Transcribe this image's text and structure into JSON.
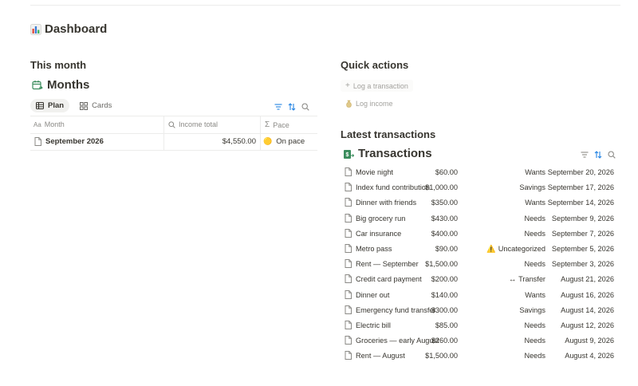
{
  "page": {
    "title": "Dashboard",
    "icon": "bar-chart-icon"
  },
  "left": {
    "section_title": "This month",
    "database": {
      "title": "Months",
      "icon": "calendar-icon",
      "views": [
        {
          "label": "Plan",
          "icon": "table-icon",
          "active": true
        },
        {
          "label": "Cards",
          "icon": "grid-icon",
          "active": false
        }
      ],
      "columns": [
        {
          "label": "Month",
          "icon": "text-property-icon"
        },
        {
          "label": "Income total",
          "icon": "search-property-icon"
        },
        {
          "label": "Pace",
          "icon": "sigma-icon"
        }
      ],
      "rows": [
        {
          "month": "September 2026",
          "income_total": "$4,550.00",
          "pace_emoji": "🟡",
          "pace": "On pace"
        }
      ]
    }
  },
  "right": {
    "quick_actions_title": "Quick actions",
    "quick_actions": [
      {
        "label": "Log a transaction",
        "icon": "plus-icon"
      },
      {
        "label": "Log income",
        "icon": "money-bag-icon"
      }
    ],
    "latest_title": "Latest transactions",
    "database": {
      "title": "Transactions",
      "icon": "money-icon",
      "rows": [
        {
          "name": "Movie night",
          "amount": "$60.00",
          "category": "Wants",
          "date": "September 20, 2026"
        },
        {
          "name": "Index fund contribution",
          "amount": "$1,000.00",
          "category": "Savings",
          "date": "September 17, 2026"
        },
        {
          "name": "Dinner with friends",
          "amount": "$350.00",
          "category": "Wants",
          "date": "September 14, 2026"
        },
        {
          "name": "Big grocery run",
          "amount": "$430.00",
          "category": "Needs",
          "date": "September 9, 2026"
        },
        {
          "name": "Car insurance",
          "amount": "$400.00",
          "category": "Needs",
          "date": "September 7, 2026"
        },
        {
          "name": "Metro pass",
          "amount": "$90.00",
          "category": "Uncategorized",
          "category_icon": "⚠️",
          "date": "September 5, 2026"
        },
        {
          "name": "Rent — September",
          "amount": "$1,500.00",
          "category": "Needs",
          "date": "September 3, 2026"
        },
        {
          "name": "Credit card payment",
          "amount": "$200.00",
          "category": "Transfer",
          "category_icon": "↔",
          "date": "August 21, 2026"
        },
        {
          "name": "Dinner out",
          "amount": "$140.00",
          "category": "Wants",
          "date": "August 16, 2026"
        },
        {
          "name": "Emergency fund transfer",
          "amount": "$300.00",
          "category": "Savings",
          "date": "August 14, 2026"
        },
        {
          "name": "Electric bill",
          "amount": "$85.00",
          "category": "Needs",
          "date": "August 12, 2026"
        },
        {
          "name": "Groceries — early August",
          "amount": "$260.00",
          "category": "Needs",
          "date": "August 9, 2026"
        },
        {
          "name": "Rent — August",
          "amount": "$1,500.00",
          "category": "Needs",
          "date": "August 4, 2026"
        }
      ]
    }
  },
  "colors": {
    "accent": "#2383e2",
    "text": "#37352f",
    "muted": "#8b8a86",
    "border": "#ececeb"
  }
}
